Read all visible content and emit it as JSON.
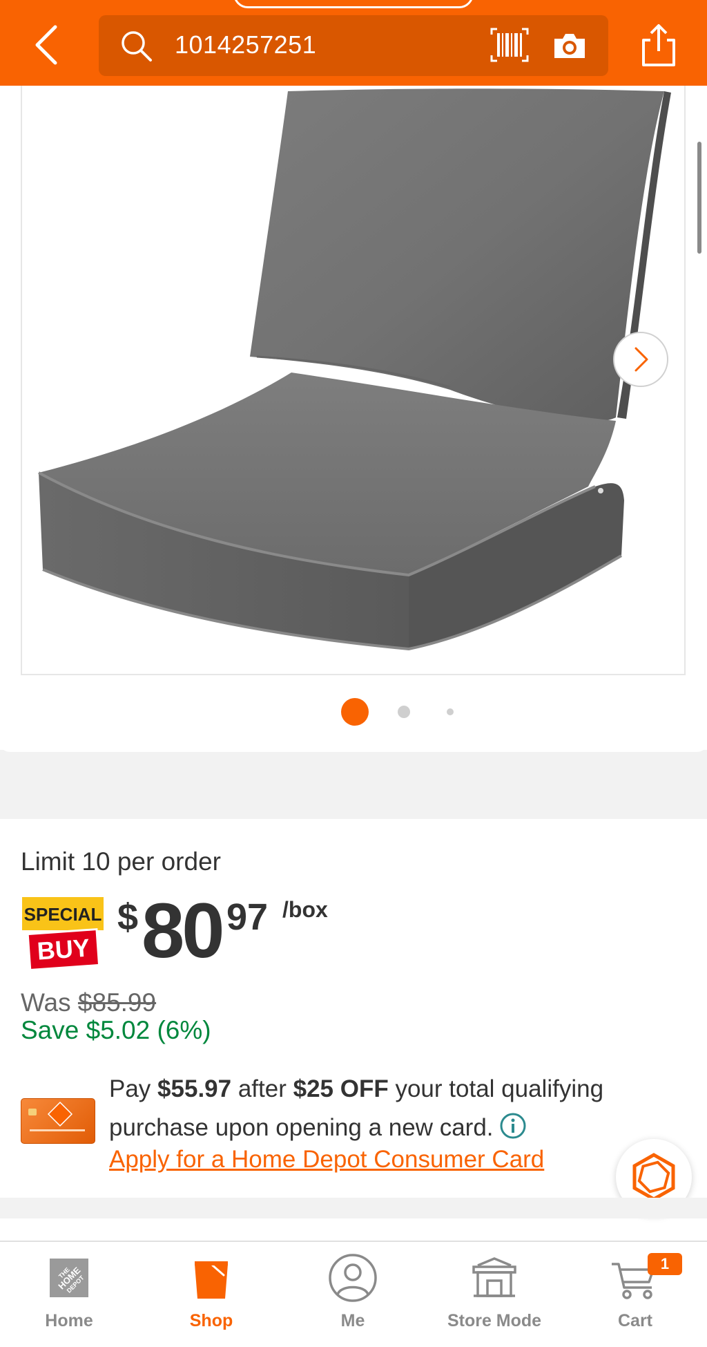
{
  "header": {
    "search_value": "1014257251"
  },
  "gallery": {
    "dot_count": 3,
    "active_index": 0
  },
  "pricing": {
    "limit_text": "Limit 10 per order",
    "badge_top": "SPECIAL",
    "badge_bottom": "BUY",
    "currency": "$",
    "price_dollars": "80",
    "price_cents": "97",
    "unit": "/box",
    "was_label": "Was",
    "was_price": "$85.99",
    "save_text": "Save $5.02 (6%)"
  },
  "promo": {
    "pay_prefix": "Pay",
    "pay_amount": "$55.97",
    "after": "after",
    "off_amount": "$25 OFF",
    "rest": "your total qualifying purchase upon opening a new card.",
    "apply_link": "Apply for a Home Depot Consumer Card"
  },
  "tabbar": {
    "tabs": [
      {
        "label": "Home",
        "icon": "home-depot-logo-icon"
      },
      {
        "label": "Shop",
        "icon": "shop-bucket-icon"
      },
      {
        "label": "Me",
        "icon": "user-icon"
      },
      {
        "label": "Store Mode",
        "icon": "store-icon"
      },
      {
        "label": "Cart",
        "icon": "cart-icon"
      }
    ],
    "active_tab": "Shop",
    "cart_count": "1"
  },
  "colors": {
    "brand_orange": "#f96302",
    "search_bg": "#d95700",
    "save_green": "#00873c",
    "info_teal": "#2b8a8e"
  }
}
